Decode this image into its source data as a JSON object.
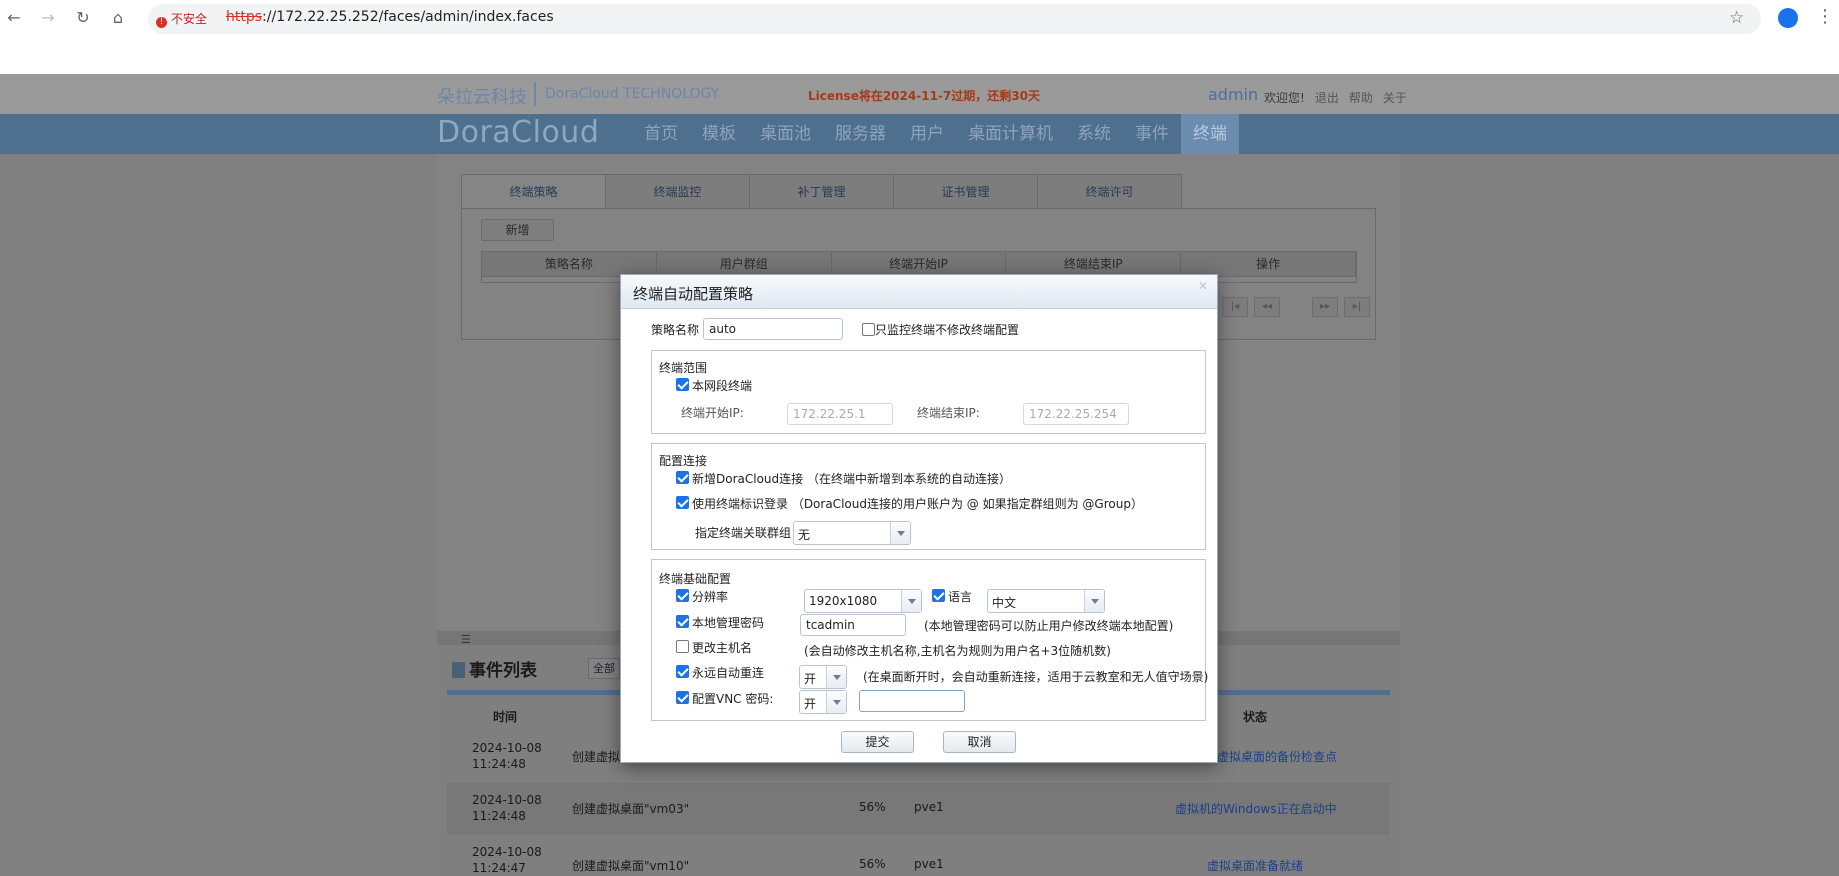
{
  "browser": {
    "insecure_label": "不安全",
    "url_scheme": "https",
    "url_rest": "://172.22.25.252/faces/admin/index.faces",
    "icons": [
      "back-icon",
      "forward-icon",
      "reload-icon",
      "home-icon",
      "star-icon",
      "profile-icon",
      "menu-icon"
    ]
  },
  "header": {
    "brand_cn": "朵拉云科技",
    "brand_en": "DoraCloud TECHNOLOGY",
    "license": "License将在2024-11-7过期，还剩30天",
    "user": "admin",
    "welcome": "欢迎您!",
    "logout": "退出",
    "help": "帮助",
    "about": "关于"
  },
  "nav": {
    "logo": "DoraCloud",
    "items": [
      "首页",
      "模板",
      "桌面池",
      "服务器",
      "用户",
      "桌面计算机",
      "系统",
      "事件",
      "终端"
    ],
    "active": "终端"
  },
  "tabs": [
    "终端策略",
    "终端监控",
    "补丁管理",
    "证书管理",
    "终端许可"
  ],
  "policy": {
    "add_label": "新增",
    "columns": [
      "策略名称",
      "用户群组",
      "终端开始IP",
      "终端结束IP",
      "操作"
    ]
  },
  "events": {
    "title": "事件列表",
    "filter": "全部",
    "col_time": "时间",
    "col_status": "状态",
    "rows": [
      {
        "date": "2024-10-08",
        "time": "11:24:48",
        "desc": "创建虚拟",
        "pct": "",
        "host": "",
        "status": "虚拟桌面的备份检查点"
      },
      {
        "date": "2024-10-08",
        "time": "11:24:48",
        "desc": "创建虚拟桌面\"vm03\"",
        "pct": "56%",
        "host": "pve1",
        "status": "虚拟机的Windows正在启动中"
      },
      {
        "date": "2024-10-08",
        "time": "11:24:47",
        "desc": "创建虚拟桌面\"vm10\"",
        "pct": "56%",
        "host": "pve1",
        "status": "虚拟桌面准备就绪"
      }
    ]
  },
  "dialog": {
    "title": "终端自动配置策略",
    "name_label": "策略名称",
    "name_value": "auto",
    "monitor_only_label": "只监控终端不修改终端配置",
    "monitor_only_checked": false,
    "range": {
      "legend": "终端范围",
      "local_segment_label": "本网段终端",
      "local_segment_checked": true,
      "start_ip_label": "终端开始IP:",
      "start_ip": "172.22.25.1",
      "end_ip_label": "终端结束IP:",
      "end_ip": "172.22.25.254"
    },
    "connection": {
      "legend": "配置连接",
      "new_conn_label": "新增DoraCloud连接 （在终端中新增到本系统的自动连接）",
      "new_conn_checked": true,
      "id_login_label": "使用终端标识登录 （DoraCloud连接的用户账户为 @ 如果指定群组则为 @Group）",
      "id_login_checked": true,
      "group_label": "指定终端关联群组",
      "group_value": "无"
    },
    "basic": {
      "legend": "终端基础配置",
      "resolution_label": "分辨率",
      "resolution_checked": true,
      "resolution_value": "1920x1080",
      "language_label": "语言",
      "language_checked": true,
      "language_value": "中文",
      "admin_pwd_label": "本地管理密码",
      "admin_pwd_checked": true,
      "admin_pwd_value": "tcadmin",
      "admin_pwd_hint": "(本地管理密码可以防止用户修改终端本地配置)",
      "hostname_label": "更改主机名",
      "hostname_checked": false,
      "hostname_hint": "(会自动修改主机名称,主机名为规则为用户名+3位随机数)",
      "reconnect_label": "永远自动重连",
      "reconnect_checked": true,
      "reconnect_value": "开",
      "reconnect_hint": "(在桌面断开时，会自动重新连接，适用于云教室和无人值守场景)",
      "vnc_label": "配置VNC 密码:",
      "vnc_checked": true,
      "vnc_value": "开",
      "vnc_password": ""
    },
    "submit_label": "提交",
    "cancel_label": "取消"
  }
}
